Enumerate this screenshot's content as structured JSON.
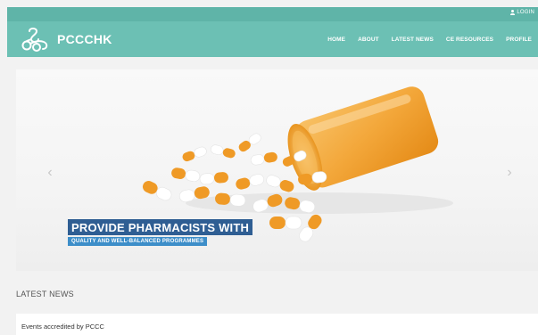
{
  "topbar": {
    "login_label": "LOGIN",
    "login_icon": "user-icon"
  },
  "brand": {
    "name": "PCCCHK",
    "logo_icon": "pccc-logo-icon"
  },
  "nav": {
    "items": [
      "HOME",
      "ABOUT",
      "LATEST NEWS",
      "CE RESOURCES",
      "PROFILE"
    ]
  },
  "hero": {
    "title": "PROVIDE PHARMACISTS WITH",
    "subtitle": "QUALITY AND WELL-BALANCED PROGRAMMES",
    "prev_glyph": "‹",
    "next_glyph": "›"
  },
  "latest_news": {
    "heading": "LATEST NEWS",
    "items": [
      "Events accredited by PCCC"
    ]
  },
  "colors": {
    "topbar": "#5fb4a8",
    "header": "#6cc0b4",
    "caption_title_bg": "#2f5e93",
    "caption_sub_bg": "#3d8ec9",
    "capsule_orange": "#ef9a26",
    "bottle_amber": "#f3a73a"
  }
}
